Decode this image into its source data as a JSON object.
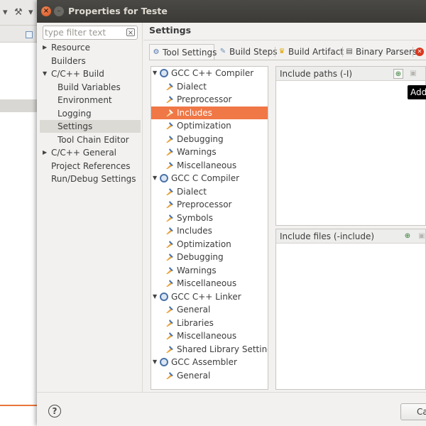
{
  "dialog": {
    "title": "Properties for Teste"
  },
  "filter": {
    "placeholder": "type filter text"
  },
  "nav": {
    "items": [
      {
        "label": "Resource"
      },
      {
        "label": "Builders"
      },
      {
        "label": "C/C++ Build"
      },
      {
        "label": "Build Variables"
      },
      {
        "label": "Environment"
      },
      {
        "label": "Logging"
      },
      {
        "label": "Settings"
      },
      {
        "label": "Tool Chain Editor"
      },
      {
        "label": "C/C++ General"
      },
      {
        "label": "Project References"
      },
      {
        "label": "Run/Debug Settings"
      }
    ],
    "selected": "Settings"
  },
  "page": {
    "title": "Settings"
  },
  "tabs": [
    {
      "label": "Tool Settings",
      "icon": "tool-settings-icon"
    },
    {
      "label": "Build Steps",
      "icon": "build-steps-icon"
    },
    {
      "label": "Build Artifact",
      "icon": "build-artifact-icon"
    },
    {
      "label": "Binary Parsers",
      "icon": "binary-parsers-icon"
    }
  ],
  "tree": {
    "items": [
      {
        "label": "GCC C++ Compiler",
        "level": 0
      },
      {
        "label": "Dialect",
        "level": 1
      },
      {
        "label": "Preprocessor",
        "level": 1
      },
      {
        "label": "Includes",
        "level": 1
      },
      {
        "label": "Optimization",
        "level": 1
      },
      {
        "label": "Debugging",
        "level": 1
      },
      {
        "label": "Warnings",
        "level": 1
      },
      {
        "label": "Miscellaneous",
        "level": 1
      },
      {
        "label": "GCC C Compiler",
        "level": 0
      },
      {
        "label": "Dialect",
        "level": 1
      },
      {
        "label": "Preprocessor",
        "level": 1
      },
      {
        "label": "Symbols",
        "level": 1
      },
      {
        "label": "Includes",
        "level": 1
      },
      {
        "label": "Optimization",
        "level": 1
      },
      {
        "label": "Debugging",
        "level": 1
      },
      {
        "label": "Warnings",
        "level": 1
      },
      {
        "label": "Miscellaneous",
        "level": 1
      },
      {
        "label": "GCC C++ Linker",
        "level": 0
      },
      {
        "label": "General",
        "level": 1
      },
      {
        "label": "Libraries",
        "level": 1
      },
      {
        "label": "Miscellaneous",
        "level": 1
      },
      {
        "label": "Shared Library Settings",
        "level": 1
      },
      {
        "label": "GCC Assembler",
        "level": 0
      },
      {
        "label": "General",
        "level": 1
      }
    ],
    "selected_index": 3
  },
  "panes": {
    "include_paths": {
      "title": "Include paths (-I)"
    },
    "include_files": {
      "title": "Include files (-include)"
    }
  },
  "tooltip": {
    "text": "Add"
  },
  "buttons": {
    "help": "?",
    "cancel": "Cancel"
  },
  "colors": {
    "selection": "#f07746",
    "titlebar": "#3b3a36",
    "tooltip_bg": "#000000"
  }
}
